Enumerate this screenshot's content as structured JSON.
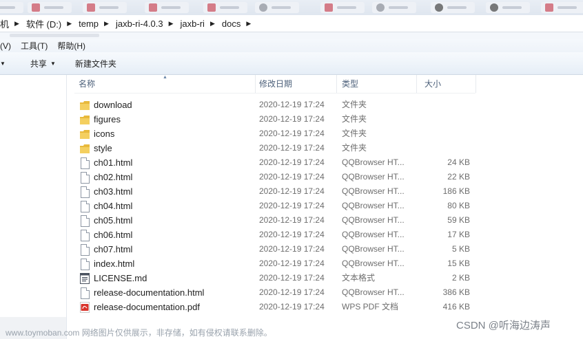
{
  "breadcrumb": [
    {
      "label": "机"
    },
    {
      "label": "软件 (D:)"
    },
    {
      "label": "temp"
    },
    {
      "label": "jaxb-ri-4.0.3"
    },
    {
      "label": "jaxb-ri"
    },
    {
      "label": "docs"
    }
  ],
  "menu": {
    "view": "(V)",
    "tools": "工具(T)",
    "help": "帮助(H)"
  },
  "commands": {
    "share": "共享",
    "new_folder": "新建文件夹"
  },
  "columns": {
    "name": "名称",
    "date": "修改日期",
    "type": "类型",
    "size": "大小"
  },
  "files": [
    {
      "name": "download",
      "date": "2020-12-19 17:24",
      "type": "文件夹",
      "size": "",
      "icon": "folder-icon"
    },
    {
      "name": "figures",
      "date": "2020-12-19 17:24",
      "type": "文件夹",
      "size": "",
      "icon": "folder-icon"
    },
    {
      "name": "icons",
      "date": "2020-12-19 17:24",
      "type": "文件夹",
      "size": "",
      "icon": "folder-icon"
    },
    {
      "name": "style",
      "date": "2020-12-19 17:24",
      "type": "文件夹",
      "size": "",
      "icon": "folder-icon"
    },
    {
      "name": "ch01.html",
      "date": "2020-12-19 17:24",
      "type": "QQBrowser HT...",
      "size": "24 KB",
      "icon": "html-file-icon"
    },
    {
      "name": "ch02.html",
      "date": "2020-12-19 17:24",
      "type": "QQBrowser HT...",
      "size": "22 KB",
      "icon": "html-file-icon"
    },
    {
      "name": "ch03.html",
      "date": "2020-12-19 17:24",
      "type": "QQBrowser HT...",
      "size": "186 KB",
      "icon": "html-file-icon"
    },
    {
      "name": "ch04.html",
      "date": "2020-12-19 17:24",
      "type": "QQBrowser HT...",
      "size": "80 KB",
      "icon": "html-file-icon"
    },
    {
      "name": "ch05.html",
      "date": "2020-12-19 17:24",
      "type": "QQBrowser HT...",
      "size": "59 KB",
      "icon": "html-file-icon"
    },
    {
      "name": "ch06.html",
      "date": "2020-12-19 17:24",
      "type": "QQBrowser HT...",
      "size": "17 KB",
      "icon": "html-file-icon"
    },
    {
      "name": "ch07.html",
      "date": "2020-12-19 17:24",
      "type": "QQBrowser HT...",
      "size": "5 KB",
      "icon": "html-file-icon"
    },
    {
      "name": "index.html",
      "date": "2020-12-19 17:24",
      "type": "QQBrowser HT...",
      "size": "15 KB",
      "icon": "html-file-icon"
    },
    {
      "name": "LICENSE.md",
      "date": "2020-12-19 17:24",
      "type": "文本格式",
      "size": "2 KB",
      "icon": "text-file-icon"
    },
    {
      "name": "release-documentation.html",
      "date": "2020-12-19 17:24",
      "type": "QQBrowser HT...",
      "size": "386 KB",
      "icon": "html-file-icon"
    },
    {
      "name": "release-documentation.pdf",
      "date": "2020-12-19 17:24",
      "type": "WPS PDF 文档",
      "size": "416 KB",
      "icon": "pdf-file-icon"
    }
  ],
  "watermark": {
    "left": "www.toymoban.com 网络图片仅供展示，非存储，如有侵权请联系删除。",
    "right": "CSDN @听海边涛声"
  },
  "colors": {
    "folder": "#e8b93c",
    "pdf": "#d9342b",
    "header_text": "#4c607a"
  }
}
